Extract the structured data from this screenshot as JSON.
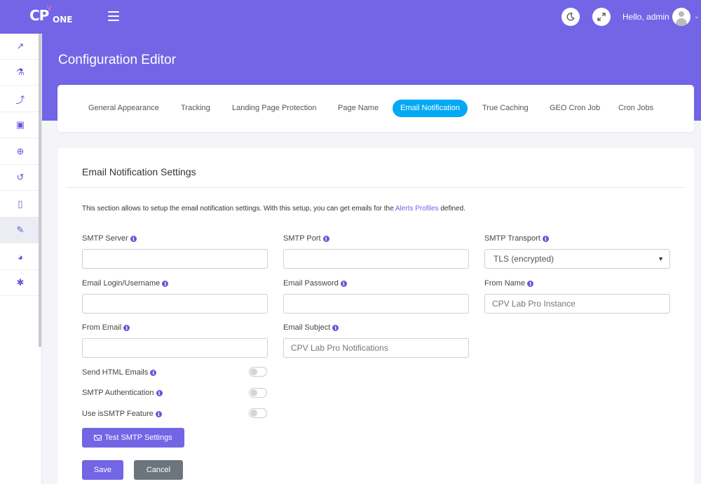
{
  "header": {
    "logo_main": "CP",
    "logo_accent": "V",
    "logo_sub": "ONE",
    "greeting": "Hello, admin",
    "theme_icon": "moon-icon",
    "fullscreen_icon": "expand-icon",
    "menu_icon": "hamburger-icon"
  },
  "sidebar": {
    "items": [
      {
        "name": "chart-line-icon",
        "glyph": "↗"
      },
      {
        "name": "flask-icon",
        "glyph": "⚗"
      },
      {
        "name": "trend-icon",
        "glyph": "⤴"
      },
      {
        "name": "briefcase-icon",
        "glyph": "▣"
      },
      {
        "name": "globe-icon",
        "glyph": "⊕"
      },
      {
        "name": "history-icon",
        "glyph": "↺"
      },
      {
        "name": "clipboard-icon",
        "glyph": "▯"
      },
      {
        "name": "wrench-icon",
        "glyph": "✎"
      },
      {
        "name": "pie-chart-icon",
        "glyph": "◕"
      },
      {
        "name": "gift-icon",
        "glyph": "✱"
      }
    ]
  },
  "page": {
    "title": "Configuration Editor"
  },
  "tabs": [
    {
      "label": "General Appearance",
      "active": false
    },
    {
      "label": "Tracking",
      "active": false
    },
    {
      "label": "Landing Page Protection",
      "active": false
    },
    {
      "label": "Page Name",
      "active": false
    },
    {
      "label": "Email Notification",
      "active": true
    },
    {
      "label": "True Caching",
      "active": false
    },
    {
      "label": "GEO Cron Job",
      "active": false
    },
    {
      "label": "Cron Jobs",
      "active": false
    }
  ],
  "settings": {
    "title": "Email Notification Settings",
    "description_before": "This section allows to setup the email notification settings. With this setup, you can get emails for the ",
    "description_link": "Alerts Profiles",
    "description_after": " defined.",
    "info_glyph": "i",
    "fields": {
      "smtp_server": {
        "label": "SMTP Server",
        "value": "",
        "placeholder": ""
      },
      "smtp_port": {
        "label": "SMTP Port",
        "value": "",
        "placeholder": ""
      },
      "smtp_transport": {
        "label": "SMTP Transport",
        "value": "TLS (encrypted)"
      },
      "email_login": {
        "label": "Email Login/Username",
        "value": "",
        "placeholder": ""
      },
      "email_password": {
        "label": "Email Password",
        "value": "",
        "placeholder": ""
      },
      "from_name": {
        "label": "From Name",
        "value": "",
        "placeholder": "CPV Lab Pro Instance"
      },
      "from_email": {
        "label": "From Email",
        "value": "",
        "placeholder": ""
      },
      "email_subject": {
        "label": "Email Subject",
        "value": "",
        "placeholder": "CPV Lab Pro Notifications"
      }
    },
    "toggles": [
      {
        "label": "Send HTML Emails",
        "on": false
      },
      {
        "label": "SMTP Authentication",
        "on": false
      },
      {
        "label": "Use isSMTP Feature",
        "on": false
      }
    ],
    "test_button": "Test SMTP Settings",
    "save_button": "Save",
    "cancel_button": "Cancel"
  },
  "colors": {
    "brand": "#7265e6",
    "active_tab": "#03a9f4",
    "cancel": "#6c757d"
  }
}
